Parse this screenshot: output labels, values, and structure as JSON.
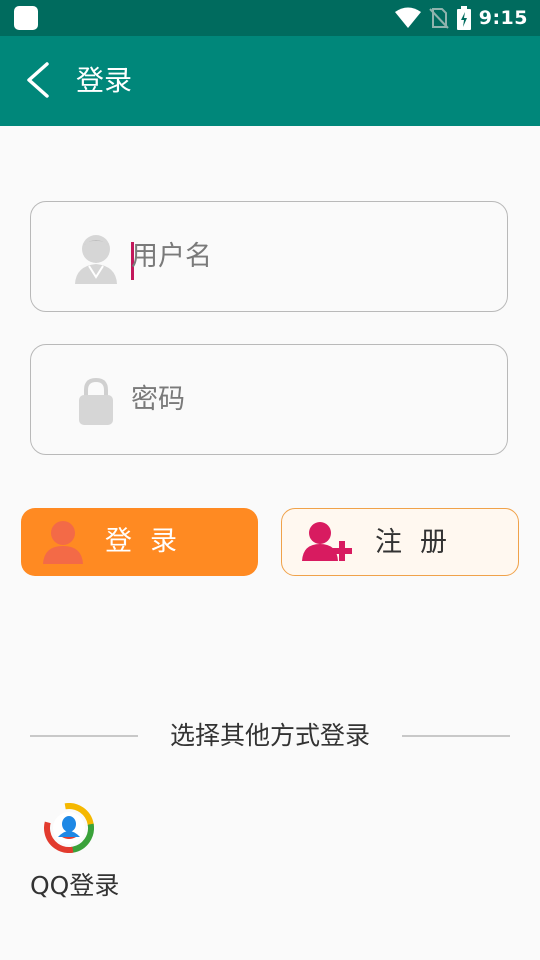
{
  "status_bar": {
    "time": "9:15",
    "icons": [
      "app-notification-icon",
      "wifi-icon",
      "no-sim-icon",
      "battery-charging-icon"
    ]
  },
  "app_bar": {
    "back_icon": "chevron-left-icon",
    "title": "登录"
  },
  "form": {
    "username": {
      "placeholder": "用户名",
      "value": "",
      "icon": "user-avatar-icon"
    },
    "password": {
      "placeholder": "密码",
      "value": "",
      "icon": "lock-icon"
    }
  },
  "actions": {
    "login_label": "登录",
    "register_label": "注册"
  },
  "other_login": {
    "divider_text": "选择其他方式登录",
    "qq_label": "QQ登录"
  },
  "colors": {
    "status_bar": "#006b5e",
    "app_bar": "#00877a",
    "login_button": "#ff8a22",
    "register_icon": "#d81b60",
    "caret": "#c2185b"
  }
}
